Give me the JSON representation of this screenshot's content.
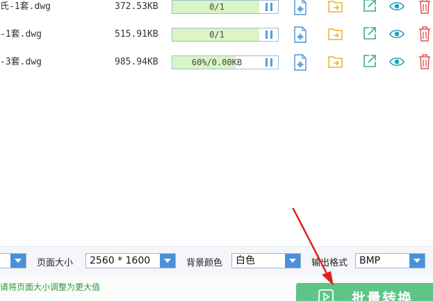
{
  "files": [
    {
      "name": "氏-1套.dwg",
      "size": "372.53KB",
      "progress": "0/1",
      "progress_fraction": 0.82
    },
    {
      "name": "-1套.dwg",
      "size": "515.91KB",
      "progress": "0/1",
      "progress_fraction": 0.82
    },
    {
      "name": "-3套.dwg",
      "size": "985.94KB",
      "progress": "60%/0.00KB",
      "progress_fraction": 0.6
    }
  ],
  "settings": {
    "page_size_label": "页面大小",
    "page_size_value": "2560 * 1600",
    "bg_color_label": "背景颜色",
    "bg_color_value": "白色",
    "output_format_label": "输出格式",
    "output_format_value": "BMP"
  },
  "footer": {
    "hint": "请将页面大小调整为更大值",
    "convert_label": "批量转换"
  },
  "colors": {
    "progress_fill": "#d8f5c3",
    "accent_blue": "#4a90d9",
    "folder_yellow": "#e6b422",
    "open_green": "#3ab07a",
    "view_teal": "#17a2b8",
    "delete_red": "#e05050",
    "convert_green": "#5ec488",
    "annotation_arrow": "#e02020"
  }
}
